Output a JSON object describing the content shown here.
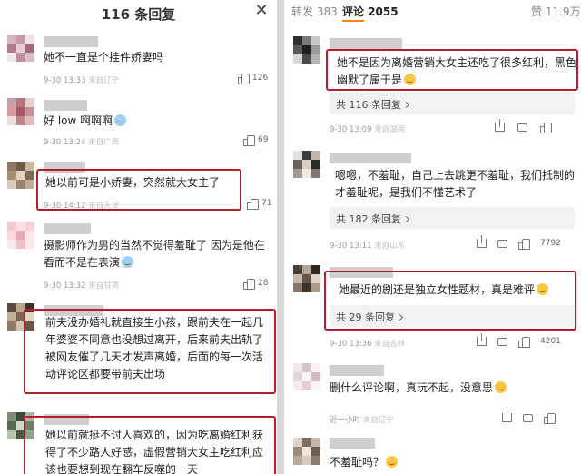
{
  "left_panel": {
    "title": "116 条回复",
    "close_icon": "close-icon",
    "comments": [
      {
        "text": "她不一直是个挂件娇妻吗",
        "time": "9-30 13:33",
        "location": "来自辽宁",
        "likes": "126"
      },
      {
        "text": "好 low 啊啊啊",
        "time": "9-30 13:24",
        "location": "来自广西",
        "likes": "69"
      },
      {
        "text": "她以前可是小娇妻，突然就大女主了",
        "time": "9-30 14:12",
        "location": "来自天津",
        "likes": "71"
      },
      {
        "text": "摄影师作为男的当然不觉得羞耻了 因为是他在看而不是在表演",
        "time": "9-30 13:32",
        "location": "来自甘肃",
        "likes": "28"
      },
      {
        "text": "前夫没办婚礼就直接生小孩，跟前夫在一起几年婆婆不同意也没想过离开，后来前夫出轨了被网友催了几天才发声离婚，后面的每一次活动评论区都要带前夫出场",
        "time": "",
        "location": "",
        "likes": ""
      },
      {
        "text": "她以前就挺不讨人喜欢的，因为吃离婚红利获得了不少路人好感，虚假营销大女主吃红利应该也要想到现在翻车反噬的一天",
        "time": "",
        "location": "",
        "likes": ""
      }
    ]
  },
  "right_panel": {
    "tabs": [
      {
        "label": "转发",
        "count": "383"
      },
      {
        "label": "评论",
        "count": "2055"
      },
      {
        "label": "赞",
        "count": "11.9万"
      }
    ],
    "comments": [
      {
        "text": "她不是因为离婚营销大女主还吃了很多红利，黑色幽默了属于是",
        "reply": "共 116 条回复",
        "time": "9-30 13:09",
        "location": "来自湖南",
        "likes": ""
      },
      {
        "text": "嗯嗯，不羞耻，自己上去跳更不羞耻，我们抵制的才羞耻呢，是我们不懂艺术了",
        "reply": "共 182 条回复",
        "time": "9-30 13:11",
        "location": "来自山东",
        "likes": "7792"
      },
      {
        "text": "她最近的剧还是独立女性题材，真是难评",
        "reply": "共 29 条回复",
        "time": "9-30 13:36",
        "location": "来自吉林",
        "likes": "4201"
      },
      {
        "text": "删什么评论啊，真玩不起，没意思",
        "reply": "",
        "time": "近一小时",
        "location": "来自辽宁",
        "likes": ""
      },
      {
        "text": "不羞耻吗？",
        "reply": "",
        "time": "",
        "location": "",
        "likes": ""
      }
    ]
  },
  "colors": {
    "highlight": "#b71c2c",
    "accent": "#ff8200"
  }
}
